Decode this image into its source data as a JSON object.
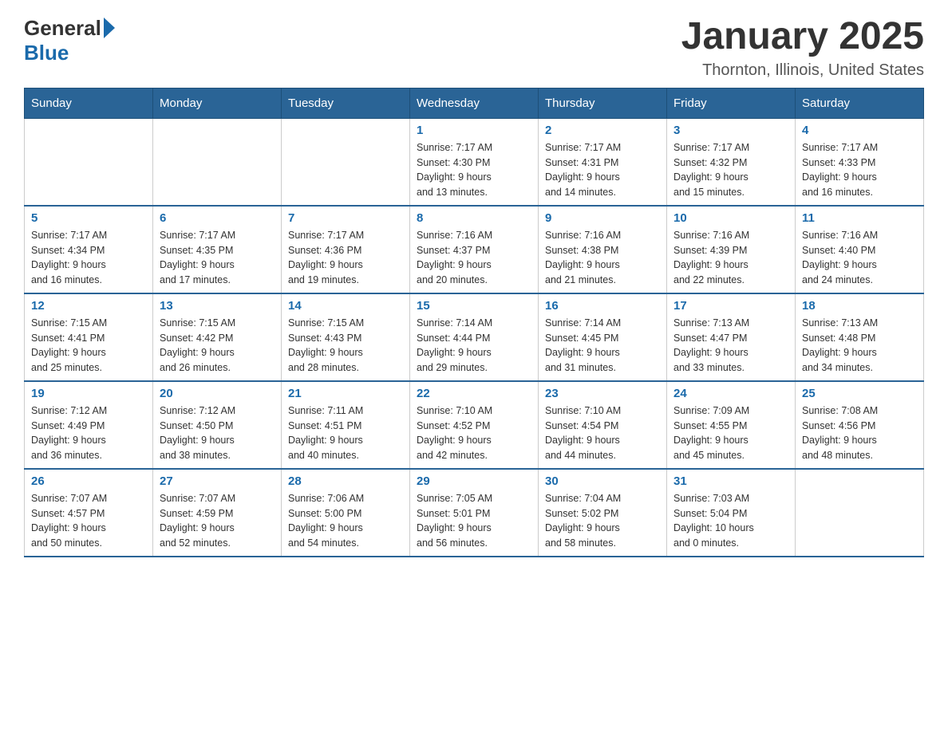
{
  "header": {
    "logo_general": "General",
    "logo_blue": "Blue",
    "title": "January 2025",
    "subtitle": "Thornton, Illinois, United States"
  },
  "calendar": {
    "days_of_week": [
      "Sunday",
      "Monday",
      "Tuesday",
      "Wednesday",
      "Thursday",
      "Friday",
      "Saturday"
    ],
    "weeks": [
      [
        {
          "day": "",
          "info": ""
        },
        {
          "day": "",
          "info": ""
        },
        {
          "day": "",
          "info": ""
        },
        {
          "day": "1",
          "info": "Sunrise: 7:17 AM\nSunset: 4:30 PM\nDaylight: 9 hours\nand 13 minutes."
        },
        {
          "day": "2",
          "info": "Sunrise: 7:17 AM\nSunset: 4:31 PM\nDaylight: 9 hours\nand 14 minutes."
        },
        {
          "day": "3",
          "info": "Sunrise: 7:17 AM\nSunset: 4:32 PM\nDaylight: 9 hours\nand 15 minutes."
        },
        {
          "day": "4",
          "info": "Sunrise: 7:17 AM\nSunset: 4:33 PM\nDaylight: 9 hours\nand 16 minutes."
        }
      ],
      [
        {
          "day": "5",
          "info": "Sunrise: 7:17 AM\nSunset: 4:34 PM\nDaylight: 9 hours\nand 16 minutes."
        },
        {
          "day": "6",
          "info": "Sunrise: 7:17 AM\nSunset: 4:35 PM\nDaylight: 9 hours\nand 17 minutes."
        },
        {
          "day": "7",
          "info": "Sunrise: 7:17 AM\nSunset: 4:36 PM\nDaylight: 9 hours\nand 19 minutes."
        },
        {
          "day": "8",
          "info": "Sunrise: 7:16 AM\nSunset: 4:37 PM\nDaylight: 9 hours\nand 20 minutes."
        },
        {
          "day": "9",
          "info": "Sunrise: 7:16 AM\nSunset: 4:38 PM\nDaylight: 9 hours\nand 21 minutes."
        },
        {
          "day": "10",
          "info": "Sunrise: 7:16 AM\nSunset: 4:39 PM\nDaylight: 9 hours\nand 22 minutes."
        },
        {
          "day": "11",
          "info": "Sunrise: 7:16 AM\nSunset: 4:40 PM\nDaylight: 9 hours\nand 24 minutes."
        }
      ],
      [
        {
          "day": "12",
          "info": "Sunrise: 7:15 AM\nSunset: 4:41 PM\nDaylight: 9 hours\nand 25 minutes."
        },
        {
          "day": "13",
          "info": "Sunrise: 7:15 AM\nSunset: 4:42 PM\nDaylight: 9 hours\nand 26 minutes."
        },
        {
          "day": "14",
          "info": "Sunrise: 7:15 AM\nSunset: 4:43 PM\nDaylight: 9 hours\nand 28 minutes."
        },
        {
          "day": "15",
          "info": "Sunrise: 7:14 AM\nSunset: 4:44 PM\nDaylight: 9 hours\nand 29 minutes."
        },
        {
          "day": "16",
          "info": "Sunrise: 7:14 AM\nSunset: 4:45 PM\nDaylight: 9 hours\nand 31 minutes."
        },
        {
          "day": "17",
          "info": "Sunrise: 7:13 AM\nSunset: 4:47 PM\nDaylight: 9 hours\nand 33 minutes."
        },
        {
          "day": "18",
          "info": "Sunrise: 7:13 AM\nSunset: 4:48 PM\nDaylight: 9 hours\nand 34 minutes."
        }
      ],
      [
        {
          "day": "19",
          "info": "Sunrise: 7:12 AM\nSunset: 4:49 PM\nDaylight: 9 hours\nand 36 minutes."
        },
        {
          "day": "20",
          "info": "Sunrise: 7:12 AM\nSunset: 4:50 PM\nDaylight: 9 hours\nand 38 minutes."
        },
        {
          "day": "21",
          "info": "Sunrise: 7:11 AM\nSunset: 4:51 PM\nDaylight: 9 hours\nand 40 minutes."
        },
        {
          "day": "22",
          "info": "Sunrise: 7:10 AM\nSunset: 4:52 PM\nDaylight: 9 hours\nand 42 minutes."
        },
        {
          "day": "23",
          "info": "Sunrise: 7:10 AM\nSunset: 4:54 PM\nDaylight: 9 hours\nand 44 minutes."
        },
        {
          "day": "24",
          "info": "Sunrise: 7:09 AM\nSunset: 4:55 PM\nDaylight: 9 hours\nand 45 minutes."
        },
        {
          "day": "25",
          "info": "Sunrise: 7:08 AM\nSunset: 4:56 PM\nDaylight: 9 hours\nand 48 minutes."
        }
      ],
      [
        {
          "day": "26",
          "info": "Sunrise: 7:07 AM\nSunset: 4:57 PM\nDaylight: 9 hours\nand 50 minutes."
        },
        {
          "day": "27",
          "info": "Sunrise: 7:07 AM\nSunset: 4:59 PM\nDaylight: 9 hours\nand 52 minutes."
        },
        {
          "day": "28",
          "info": "Sunrise: 7:06 AM\nSunset: 5:00 PM\nDaylight: 9 hours\nand 54 minutes."
        },
        {
          "day": "29",
          "info": "Sunrise: 7:05 AM\nSunset: 5:01 PM\nDaylight: 9 hours\nand 56 minutes."
        },
        {
          "day": "30",
          "info": "Sunrise: 7:04 AM\nSunset: 5:02 PM\nDaylight: 9 hours\nand 58 minutes."
        },
        {
          "day": "31",
          "info": "Sunrise: 7:03 AM\nSunset: 5:04 PM\nDaylight: 10 hours\nand 0 minutes."
        },
        {
          "day": "",
          "info": ""
        }
      ]
    ]
  }
}
